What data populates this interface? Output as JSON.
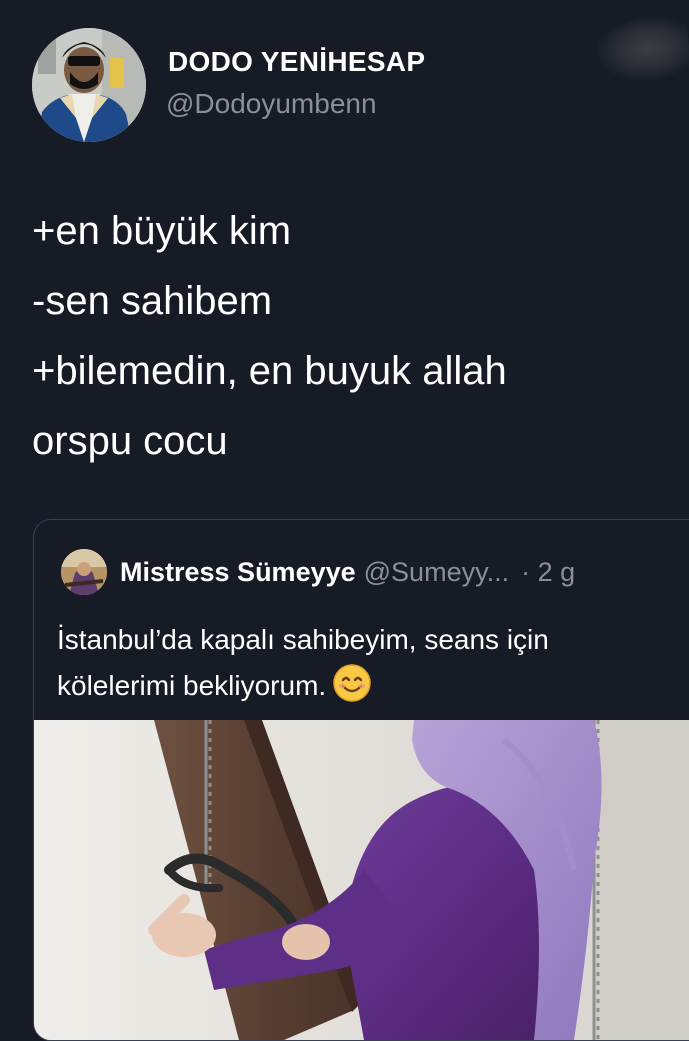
{
  "tweet": {
    "author": {
      "display_name": "DODO YENİHESAP",
      "handle": "@Dodoyumbenn"
    },
    "lines": [
      "+en büyük kim",
      "-sen sahibem",
      "+bilemedin, en buyuk allah",
      "orspu cocu"
    ]
  },
  "quoted_tweet": {
    "author": {
      "display_name": "Mistress Sümeyye",
      "handle": "@Sumeyy...",
      "time": "· 2 g"
    },
    "lines": [
      "İstanbul’da kapalı sahibeyim, seans için",
      "kölelerimi bekliyorum."
    ],
    "emoji": "smiling-face-emoji",
    "media": "photo"
  },
  "colors": {
    "background": "#161b26",
    "text_primary": "#ffffff",
    "text_secondary": "#8a8f99",
    "card_border": "#394050"
  }
}
